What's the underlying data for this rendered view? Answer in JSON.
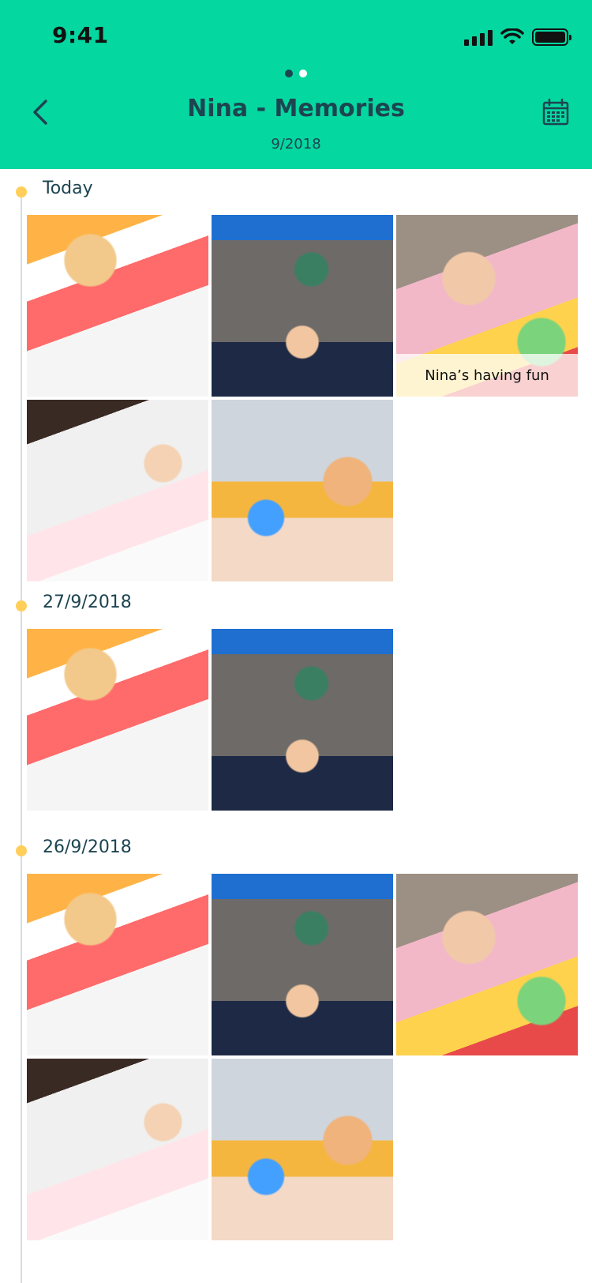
{
  "status_bar": {
    "time": "9:41"
  },
  "header": {
    "title": "Nina - Memories",
    "subtitle": "9/2018",
    "pager": {
      "count": 2,
      "active_index": 0
    },
    "back_icon": "chevron-left-icon",
    "calendar_icon": "calendar-icon",
    "background_color": "#05d7a0",
    "text_color": "#1d4451"
  },
  "timeline": {
    "dot_color": "#ffcf5a",
    "sections": [
      {
        "date": "Today",
        "photos": [
          {
            "subject": "girl-reading-book"
          },
          {
            "subject": "group-of-kids-laughing"
          },
          {
            "subject": "toddler-playing-blocks",
            "caption": "Nina’s having fun"
          },
          {
            "subject": "teacher-reading-to-kids"
          },
          {
            "subject": "child-with-toy-blocks"
          }
        ]
      },
      {
        "date": "27/9/2018",
        "photos": [
          {
            "subject": "girl-reading-book"
          },
          {
            "subject": "group-of-kids-laughing"
          }
        ]
      },
      {
        "date": "26/9/2018",
        "photos": [
          {
            "subject": "girl-reading-book"
          },
          {
            "subject": "group-of-kids-laughing"
          },
          {
            "subject": "toddler-playing-blocks"
          },
          {
            "subject": "teacher-reading-to-kids"
          },
          {
            "subject": "child-with-toy-blocks"
          }
        ]
      }
    ]
  }
}
